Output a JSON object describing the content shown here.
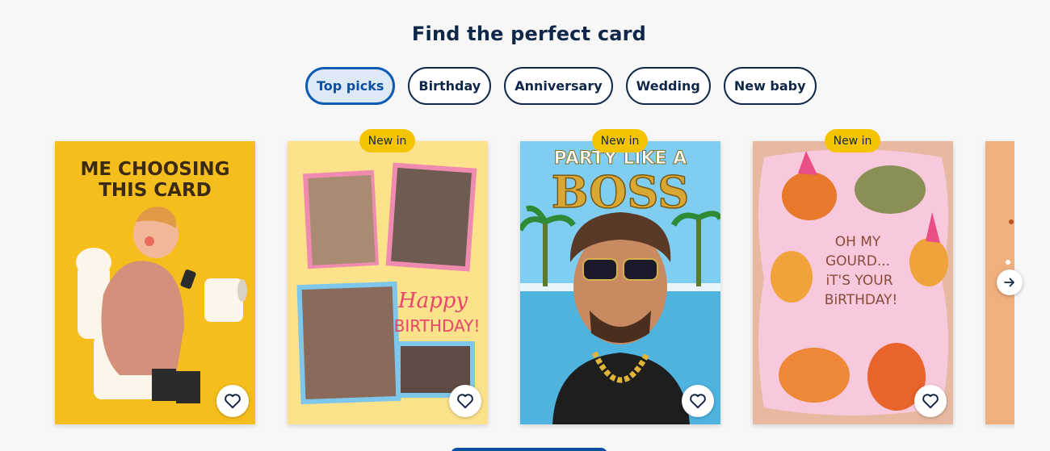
{
  "section": {
    "title": "Find the perfect card"
  },
  "tabs": [
    {
      "label": "Top picks",
      "active": true
    },
    {
      "label": "Birthday",
      "active": false
    },
    {
      "label": "Anniversary",
      "active": false
    },
    {
      "label": "Wedding",
      "active": false
    },
    {
      "label": "New baby",
      "active": false
    }
  ],
  "cards": [
    {
      "badge": "",
      "art_text": [
        "ME CHOOSING",
        "THIS CARD"
      ]
    },
    {
      "badge": "New in",
      "art_text": [
        "Happy",
        "BIRTHDAY!"
      ]
    },
    {
      "badge": "New in",
      "art_text": [
        "PARTY LIKE A",
        "BOSS"
      ]
    },
    {
      "badge": "New in",
      "art_text": [
        "OH MY",
        "GOURD...",
        "iT'S YOUR",
        "BiRTHDAY!"
      ]
    }
  ],
  "icons": {
    "favourite": "heart-outline-icon",
    "next": "arrow-right-icon"
  },
  "colors": {
    "accent": "#0b4fa0",
    "badge": "#f5c400",
    "text": "#0f2748"
  }
}
